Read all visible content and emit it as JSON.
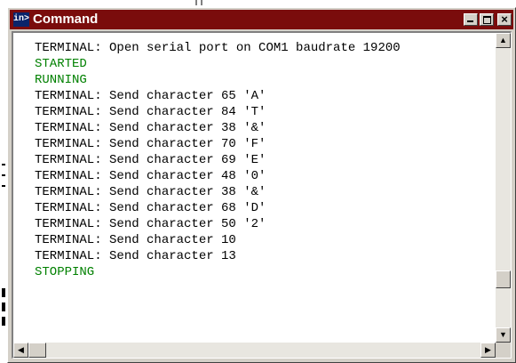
{
  "window": {
    "title": "Command",
    "icon_text": "in>",
    "title_bar_color": "#7a0c0c",
    "controls": {
      "minimize": "minimize",
      "maximize": "maximize",
      "close": "×"
    }
  },
  "console": {
    "lines": [
      {
        "text": "TERMINAL: Open serial port on COM1 baudrate 19200",
        "color": "#000000"
      },
      {
        "text": "STARTED",
        "color": "#008000"
      },
      {
        "text": "RUNNING",
        "color": "#008000"
      },
      {
        "text": "TERMINAL: Send character 65 'A'",
        "color": "#000000"
      },
      {
        "text": "TERMINAL: Send character 84 'T'",
        "color": "#000000"
      },
      {
        "text": "TERMINAL: Send character 38 '&'",
        "color": "#000000"
      },
      {
        "text": "TERMINAL: Send character 70 'F'",
        "color": "#000000"
      },
      {
        "text": "TERMINAL: Send character 69 'E'",
        "color": "#000000"
      },
      {
        "text": "TERMINAL: Send character 48 '0'",
        "color": "#000000"
      },
      {
        "text": "TERMINAL: Send character 38 '&'",
        "color": "#000000"
      },
      {
        "text": "TERMINAL: Send character 68 'D'",
        "color": "#000000"
      },
      {
        "text": "TERMINAL: Send character 50 '2'",
        "color": "#000000"
      },
      {
        "text": "TERMINAL: Send character 10",
        "color": "#000000"
      },
      {
        "text": "TERMINAL: Send character 13",
        "color": "#000000"
      },
      {
        "text": "STOPPING",
        "color": "#008000"
      }
    ]
  },
  "scrollbars": {
    "vertical_position": 0.85,
    "horizontal_position": 0.0
  },
  "icons": {
    "up": "▲",
    "down": "▼",
    "left": "◀",
    "right": "▶"
  }
}
